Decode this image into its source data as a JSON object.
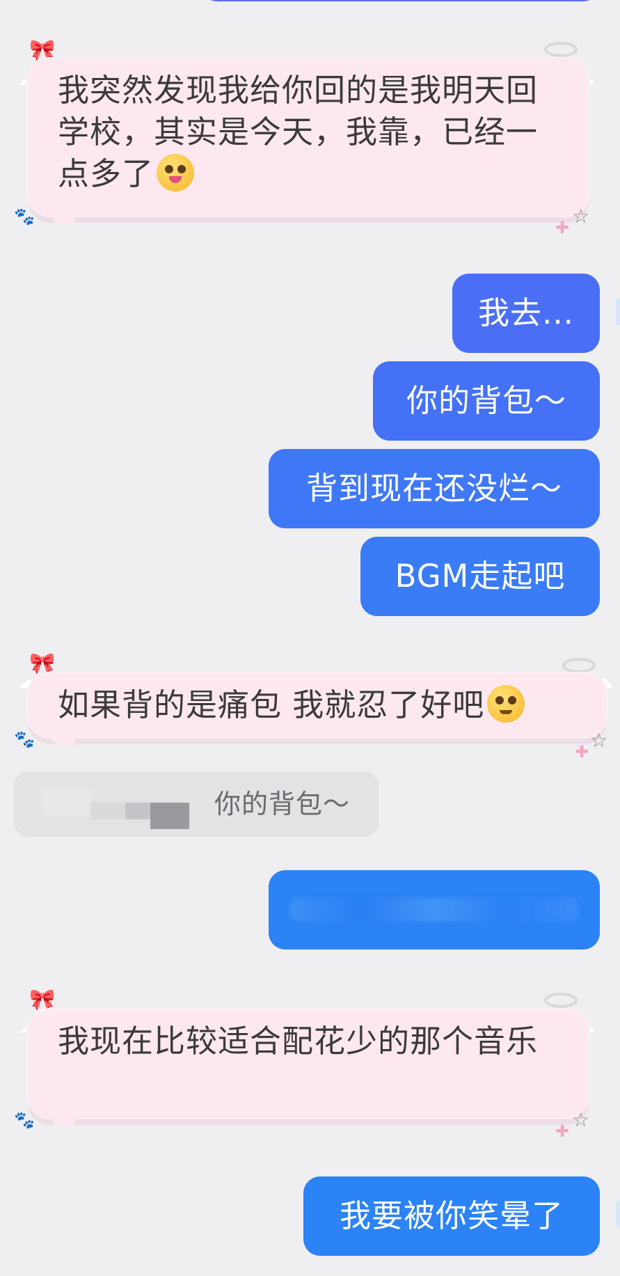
{
  "messages": {
    "m1_received": "我突然发现我给你回的是我明天回学校，其实是今天，我靠，已经一点多了",
    "m2_sent": "我去...",
    "m3_sent": "你的背包～",
    "m4_sent": "背到现在还没烂～",
    "m5_sent": "BGM走起吧",
    "m6_received": "如果背的是痛包 我就忍了好吧",
    "quote_text": "你的背包～",
    "m8_received": "我现在比较适合配花少的那个音乐",
    "m9_sent": "我要被你笑晕了"
  },
  "icons": {
    "emoji_1": "tongue-out-dizzy-face-emoji",
    "emoji_2": "pleading-face-emoji",
    "bubble_decorations": [
      "bow-icon",
      "halo-icon",
      "wing-icon",
      "paw-icon",
      "star-icon",
      "plus-icon"
    ]
  },
  "colors": {
    "background": "#efeff1",
    "received_bubble": "#fde8ef",
    "sent_indigo": "#5a6cf0",
    "sent_blue_1": "#4a6ef5",
    "sent_blue_2": "#3f78f6",
    "sent_blue_3": "#2c83f5",
    "quote_bubble": "#e3e3e6"
  }
}
